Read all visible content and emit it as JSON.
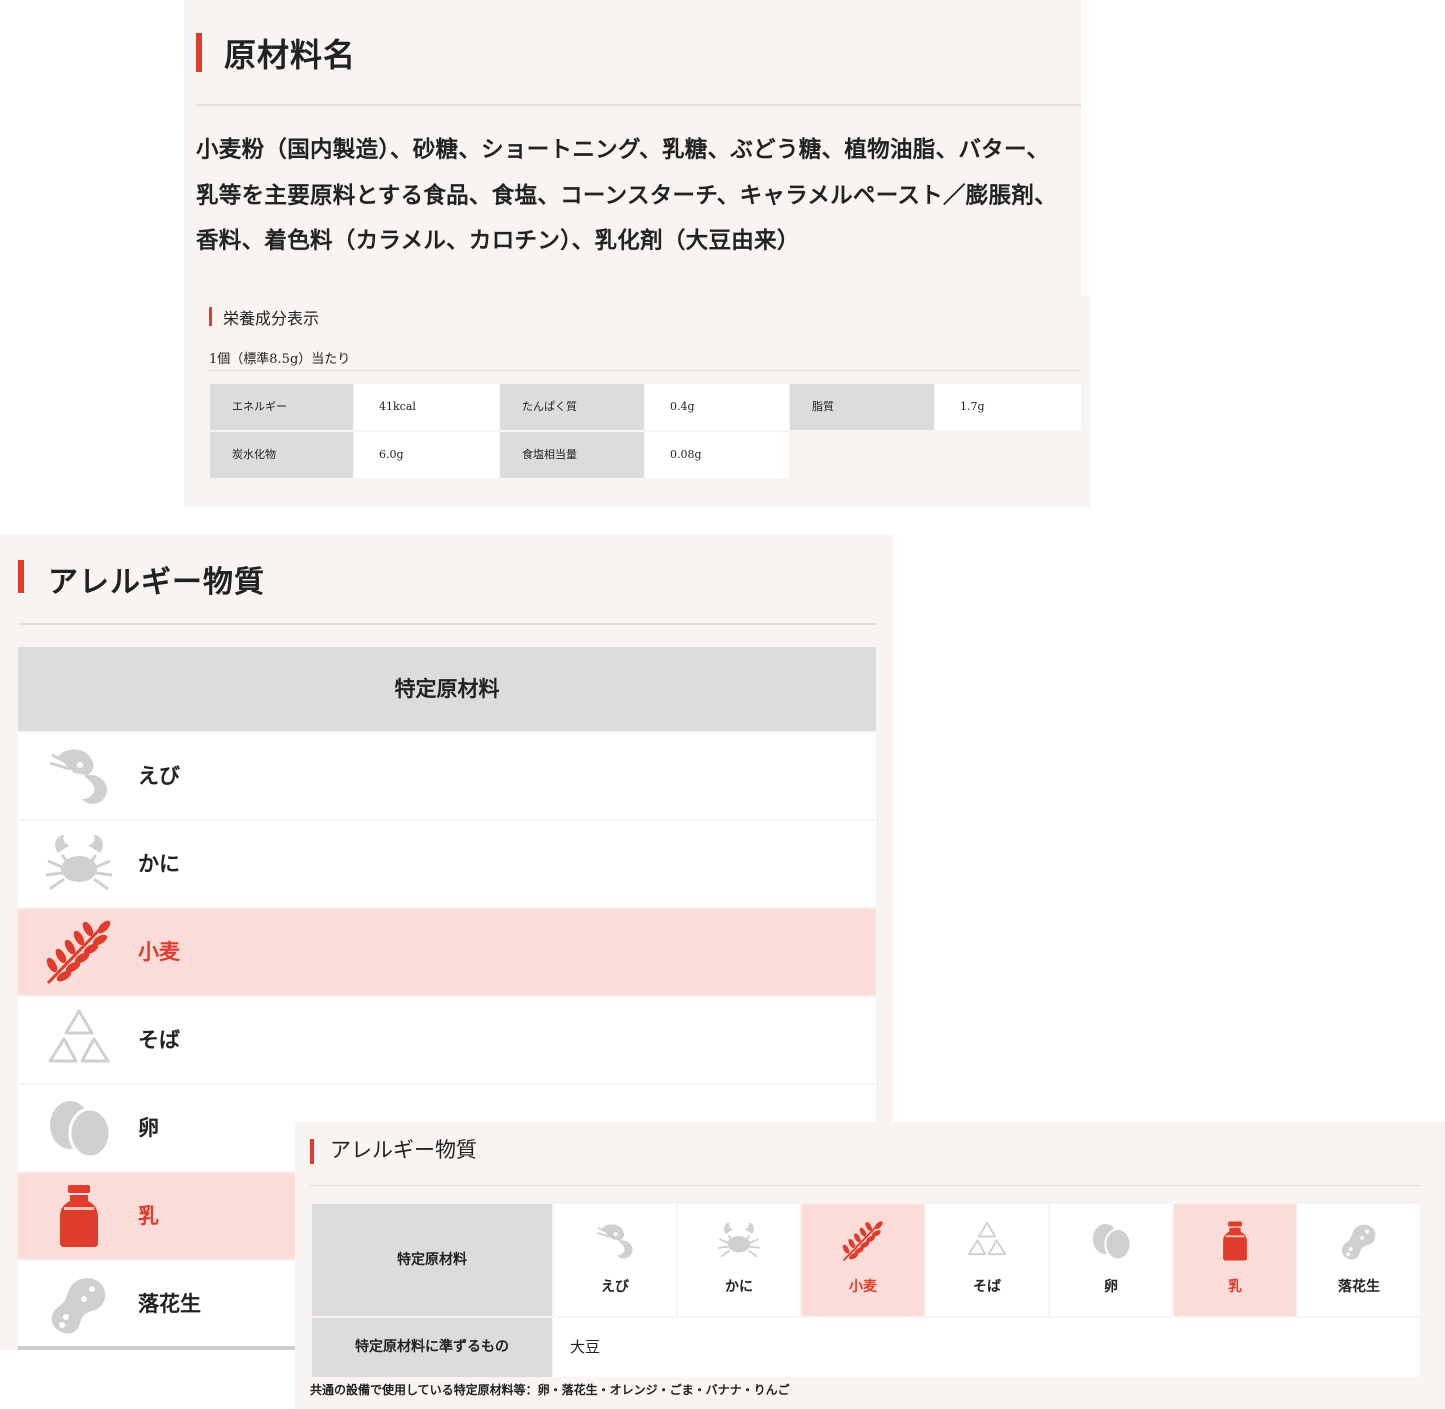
{
  "ingredients": {
    "title": "原材料名",
    "lines": [
      "小麦粉（国内製造）、砂糖、ショートニング、乳糖、ぶどう糖、植物油脂、バター、",
      "乳等を主要原料とする食品、食塩、コーンスターチ、キャラメルペースト／膨脹剤、",
      "香料、着色料（カラメル、カロチン）、乳化剤（大豆由来）"
    ]
  },
  "nutrition": {
    "title": "栄養成分表示",
    "serving": "1個（標準8.5g）当たり",
    "rows": [
      [
        {
          "label": "エネルギー",
          "value": "41kcal"
        },
        {
          "label": "たんぱく質",
          "value": "0.4g"
        },
        {
          "label": "脂質",
          "value": "1.7g"
        }
      ],
      [
        {
          "label": "炭水化物",
          "value": "6.0g"
        },
        {
          "label": "食塩相当量",
          "value": "0.08g"
        }
      ]
    ]
  },
  "allergen_list": {
    "title": "アレルギー物質",
    "header": "特定原材料",
    "items": [
      {
        "label": "えび",
        "icon": "shrimp-icon",
        "contained": false
      },
      {
        "label": "かに",
        "icon": "crab-icon",
        "contained": false
      },
      {
        "label": "小麦",
        "icon": "wheat-icon",
        "contained": true
      },
      {
        "label": "そば",
        "icon": "buckwheat-icon",
        "contained": false
      },
      {
        "label": "卵",
        "icon": "egg-icon",
        "contained": false
      },
      {
        "label": "乳",
        "icon": "milk-icon",
        "contained": true
      },
      {
        "label": "落花生",
        "icon": "peanut-icon",
        "contained": false
      }
    ]
  },
  "allergen_grid": {
    "title": "アレルギー物質",
    "header": "特定原材料",
    "items": [
      {
        "label": "えび",
        "icon": "shrimp-icon",
        "contained": false
      },
      {
        "label": "かに",
        "icon": "crab-icon",
        "contained": false
      },
      {
        "label": "小麦",
        "icon": "wheat-icon",
        "contained": true
      },
      {
        "label": "そば",
        "icon": "buckwheat-icon",
        "contained": false
      },
      {
        "label": "卵",
        "icon": "egg-icon",
        "contained": false
      },
      {
        "label": "乳",
        "icon": "milk-icon",
        "contained": true
      },
      {
        "label": "落花生",
        "icon": "peanut-icon",
        "contained": false
      }
    ],
    "sub_label": "特定原材料に準ずるもの",
    "sub_value": "大豆",
    "footnote": "共通の設備で使用している特定原材料等：卵・落花生・オレンジ・ごま・バナナ・りんご"
  },
  "colors": {
    "accent": "#e03c2c",
    "highlight": "#fcdcd9",
    "panel": "#f7f4f1",
    "label_bg": "#dcdcdc",
    "icon_gray": "#d0d0d0"
  }
}
